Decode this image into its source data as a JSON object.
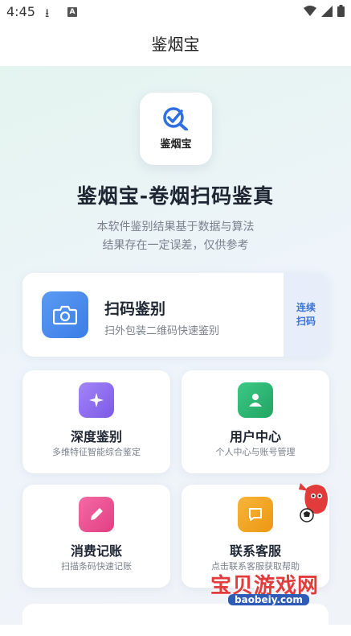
{
  "status": {
    "time": "4:45",
    "badge": "A"
  },
  "appbar": {
    "title": "鉴烟宝"
  },
  "logo": {
    "label": "鉴烟宝"
  },
  "hero": {
    "headline": "鉴烟宝-卷烟扫码鉴真",
    "line1": "本软件鉴别结果基于数据与算法",
    "line2": "结果存在一定误差，仅供参考"
  },
  "scan": {
    "title": "扫码鉴别",
    "subtitle": "扫外包装二维码快速鉴别",
    "cont1": "连续",
    "cont2": "扫码"
  },
  "tiles": [
    {
      "title": "深度鉴别",
      "subtitle": "多维特征智能综合鉴定",
      "icon": "sparkle-icon",
      "color": "#8f6ff0"
    },
    {
      "title": "用户中心",
      "subtitle": "个人中心与账号管理",
      "icon": "user-icon",
      "color": "#2fb673"
    },
    {
      "title": "消费记账",
      "subtitle": "扫描条码快速记账",
      "icon": "pencil-icon",
      "color": "#ec4f93"
    },
    {
      "title": "联系客服",
      "subtitle": "点击联系客服获取帮助",
      "icon": "chat-icon",
      "color": "#f1a21a"
    }
  ],
  "watermark": {
    "text": "宝贝游戏网",
    "url": "baobeiy.com"
  }
}
